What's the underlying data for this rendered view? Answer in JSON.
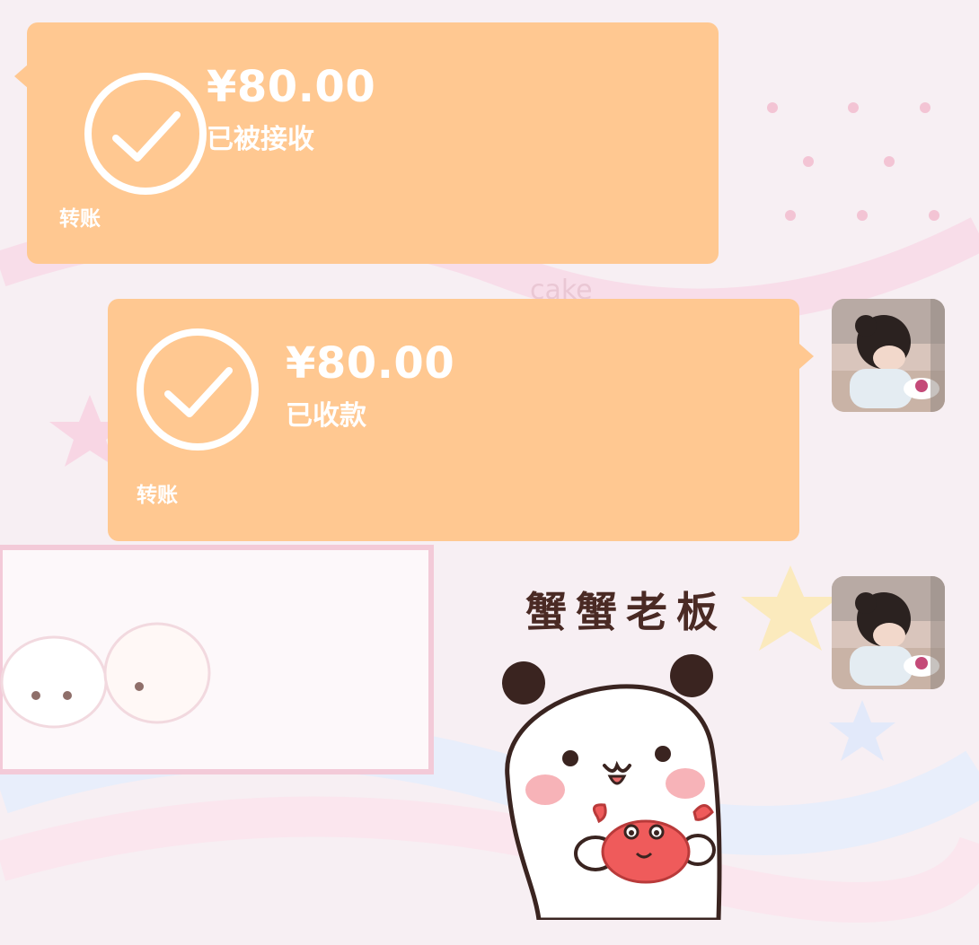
{
  "messages": [
    {
      "direction": "incoming",
      "type": "transfer",
      "amount": "¥80.00",
      "status": "已被接收",
      "label": "转账"
    },
    {
      "direction": "outgoing",
      "type": "transfer",
      "amount": "¥80.00",
      "status": "已收款",
      "label": "转账"
    },
    {
      "direction": "outgoing",
      "type": "sticker",
      "caption": "蟹蟹老板"
    }
  ],
  "colors": {
    "bubble": "#ffc891",
    "text": "#ffffff",
    "sticker_text": "#4a2a24",
    "background": "#f6eef2"
  },
  "icons": {
    "transfer_status": "check-circle-icon",
    "sticker": "panda-with-crab"
  }
}
